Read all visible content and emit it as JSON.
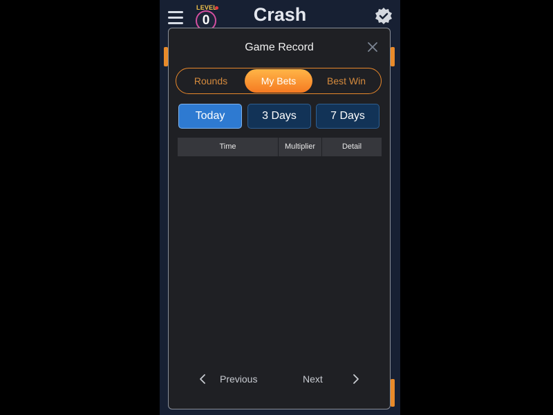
{
  "header": {
    "brand": "Crash",
    "level_label": "LEVEL",
    "level_value": "0"
  },
  "modal": {
    "title": "Game Record",
    "tabs": [
      {
        "label": "Rounds",
        "active": false
      },
      {
        "label": "My Bets",
        "active": true
      },
      {
        "label": "Best Win",
        "active": false
      }
    ],
    "periods": [
      {
        "label": "Today",
        "active": true
      },
      {
        "label": "3 Days",
        "active": false
      },
      {
        "label": "7 Days",
        "active": false
      }
    ],
    "table": {
      "columns": [
        "Time",
        "Multiplier",
        "Detail"
      ],
      "rows": []
    },
    "pagination": {
      "previous_label": "Previous",
      "next_label": "Next"
    }
  },
  "colors": {
    "accent_orange": "#f57a22",
    "active_blue": "#2e7ad1",
    "inactive_blue": "#123357",
    "modal_bg": "#1f2024"
  }
}
